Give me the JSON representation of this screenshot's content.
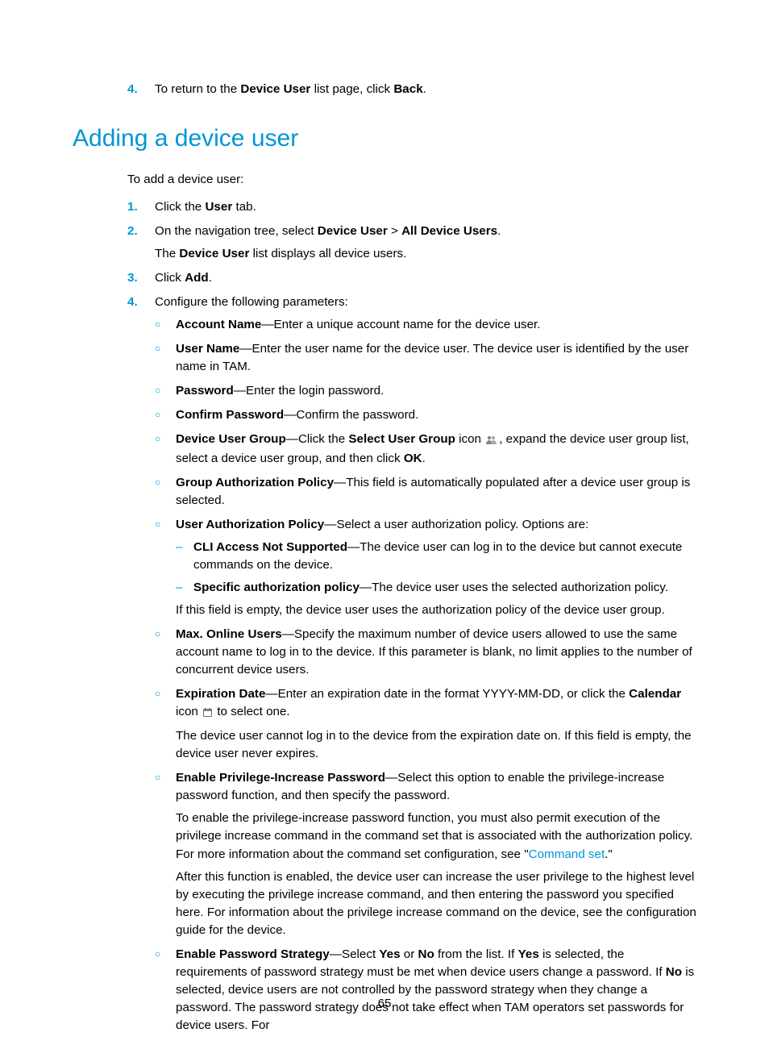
{
  "top_item": {
    "marker": "4.",
    "text_before": "To return to the ",
    "bold1": "Device User",
    "text_mid": " list page, click ",
    "bold2": "Back",
    "text_after": "."
  },
  "heading": "Adding a device user",
  "intro": "To add a device user:",
  "steps": [
    {
      "num": "1.",
      "segments": [
        {
          "t": "Click the "
        },
        {
          "b": "User"
        },
        {
          "t": " tab."
        }
      ]
    },
    {
      "num": "2.",
      "segments": [
        {
          "t": "On the navigation tree, select "
        },
        {
          "b": "Device User"
        },
        {
          "t": " > "
        },
        {
          "b": "All Device Users"
        },
        {
          "t": "."
        }
      ],
      "subline_segments": [
        {
          "t": "The "
        },
        {
          "b": "Device User"
        },
        {
          "t": " list displays all device users."
        }
      ]
    },
    {
      "num": "3.",
      "segments": [
        {
          "t": "Click "
        },
        {
          "b": "Add"
        },
        {
          "t": "."
        }
      ]
    },
    {
      "num": "4.",
      "segments": [
        {
          "t": "Configure the following parameters:"
        }
      ],
      "params": [
        {
          "lines": [
            [
              {
                "b": "Account Name"
              },
              {
                "t": "—Enter a unique account name for the device user."
              }
            ]
          ]
        },
        {
          "lines": [
            [
              {
                "b": "User Name"
              },
              {
                "t": "—Enter the user name for the device user. The device user is identified by the user name in TAM."
              }
            ]
          ]
        },
        {
          "lines": [
            [
              {
                "b": "Password"
              },
              {
                "t": "—Enter the login password."
              }
            ]
          ]
        },
        {
          "lines": [
            [
              {
                "b": "Confirm Password"
              },
              {
                "t": "—Confirm the password."
              }
            ]
          ]
        },
        {
          "lines": [
            [
              {
                "b": "Device User Group"
              },
              {
                "t": "—Click the "
              },
              {
                "b": "Select User Group"
              },
              {
                "t": " icon "
              },
              {
                "icon": "user-group-icon"
              },
              {
                "t": ", expand the device user group list, select a device user group, and then click "
              },
              {
                "b": "OK"
              },
              {
                "t": "."
              }
            ]
          ]
        },
        {
          "lines": [
            [
              {
                "b": "Group Authorization Policy"
              },
              {
                "t": "—This field is automatically populated after a device user group is selected."
              }
            ]
          ]
        },
        {
          "lines": [
            [
              {
                "b": "User Authorization Policy"
              },
              {
                "t": "—Select a user authorization policy. Options are:"
              }
            ]
          ],
          "subopts": [
            [
              {
                "b": "CLI Access Not Supported"
              },
              {
                "t": "—The device user can log in to the device but cannot execute commands on the device."
              }
            ],
            [
              {
                "b": "Specific authorization policy"
              },
              {
                "t": "—The device user uses the selected authorization policy."
              }
            ]
          ],
          "after_lines": [
            [
              {
                "t": "If this field is empty, the device user uses the authorization policy of the device user group."
              }
            ]
          ]
        },
        {
          "lines": [
            [
              {
                "b": "Max. Online Users"
              },
              {
                "t": "—Specify the maximum number of device users allowed to use the same account name to log in to the device. If this parameter is blank, no limit applies to the number of concurrent device users."
              }
            ]
          ]
        },
        {
          "lines": [
            [
              {
                "b": "Expiration Date"
              },
              {
                "t": "—Enter an expiration date in the format YYYY-MM-DD, or click the "
              },
              {
                "b": "Calendar"
              },
              {
                "t": " icon "
              },
              {
                "icon": "calendar-icon"
              },
              {
                "t": " to select one."
              }
            ]
          ],
          "after_lines": [
            [
              {
                "t": "The device user cannot log in to the device from the expiration date on. If this field is empty, the device user never expires."
              }
            ]
          ]
        },
        {
          "lines": [
            [
              {
                "b": "Enable Privilege-Increase Password"
              },
              {
                "t": "—Select this option to enable the privilege-increase password function, and then specify the password."
              }
            ]
          ],
          "after_lines": [
            [
              {
                "t": "To enable the privilege-increase password function, you must also permit execution of the privilege increase command in the command set that is associated with the authorization policy. For more information about the command set configuration, see \""
              },
              {
                "link": "Command set"
              },
              {
                "t": ".\""
              }
            ],
            [
              {
                "t": "After this function is enabled, the device user can increase the user privilege to the highest level by executing the privilege increase command, and then entering the password you specified here. For information about the privilege increase command on the device, see the configuration guide for the device."
              }
            ]
          ]
        },
        {
          "lines": [
            [
              {
                "b": "Enable Password Strategy"
              },
              {
                "t": "—Select "
              },
              {
                "b": "Yes"
              },
              {
                "t": " or "
              },
              {
                "b": "No"
              },
              {
                "t": " from the list. If "
              },
              {
                "b": "Yes"
              },
              {
                "t": " is selected, the requirements of password strategy must be met when device users change a password. If "
              },
              {
                "b": "No"
              },
              {
                "t": " is selected, device users are not controlled by the password strategy when they change a password. The password strategy does not take effect when TAM operators set passwords for device users. For"
              }
            ]
          ]
        }
      ]
    }
  ],
  "page_number": "65"
}
